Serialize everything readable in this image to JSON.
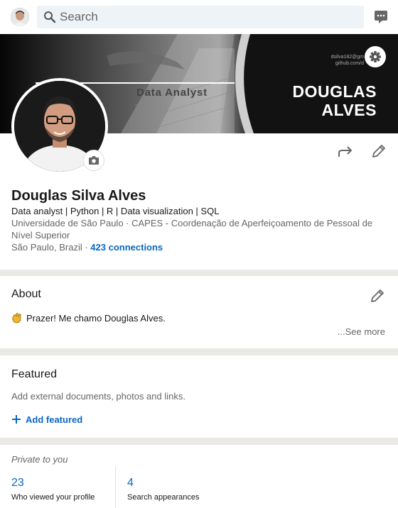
{
  "topbar": {
    "search_placeholder": "Search",
    "avatar_label": "me"
  },
  "banner": {
    "role_text": "Data Analyst",
    "name_line1": "DOUGLAS",
    "name_line2": "ALVES",
    "tiny_line1": "dsilva182@gm",
    "tiny_line2": "github.com/d"
  },
  "profile": {
    "name": "Douglas Silva Alves",
    "headline": "Data analyst | Python | R | Data visualization | SQL",
    "education": "Universidade de São Paulo  ·  CAPES - Coordenação de Aperfeiçoamento de Pessoal de Nível Superior",
    "location": "São Paulo, Brazil",
    "separator": " · ",
    "connections": "423 connections"
  },
  "about": {
    "title": "About",
    "text": "Prazer! Me chamo Douglas Alves.",
    "see_more": "...See more"
  },
  "featured": {
    "title": "Featured",
    "description": "Add external documents, photos and links.",
    "add_label": "Add featured"
  },
  "analytics": {
    "private_label": "Private to you",
    "stats": [
      {
        "value": "23",
        "label": "Who viewed your profile"
      },
      {
        "value": "4",
        "label": "Search appearances"
      }
    ]
  },
  "colors": {
    "accent": "#0a66c2",
    "background": "#ebe9e6"
  },
  "icons": [
    "search-icon",
    "messaging-icon",
    "gear-icon",
    "camera-icon",
    "share-icon",
    "edit-icon",
    "waving-hand-icon",
    "plus-icon"
  ]
}
